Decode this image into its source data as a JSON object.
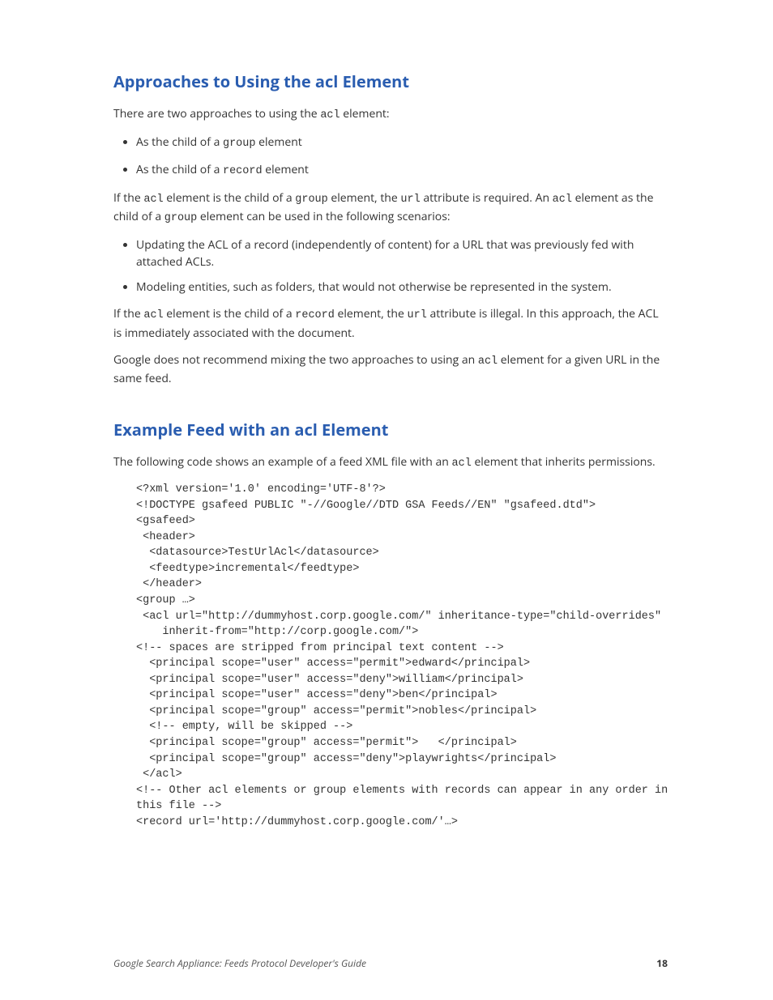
{
  "section1": {
    "heading": "Approaches to Using the acl Element",
    "intro_before": "There are two approaches to using the ",
    "intro_code": "acl",
    "intro_after": " element:",
    "bullets_a": [
      {
        "before": "As the child of a ",
        "code": "group",
        "after": " element"
      },
      {
        "before": "As the child of a ",
        "code": "record",
        "after": " element"
      }
    ],
    "p2_1": "If the ",
    "p2_c1": "acl",
    "p2_2": " element is the child of a ",
    "p2_c2": "group",
    "p2_3": " element, the ",
    "p2_c3": "url",
    "p2_4": " attribute is required. An ",
    "p2_c4": "acl",
    "p2_5": " element as the child of a ",
    "p2_c5": "group",
    "p2_6": " element can be used in the following scenarios:",
    "bullets_b": [
      "Updating the ACL of a record (independently of content) for a URL that was previously fed with attached ACLs.",
      "Modeling entities, such as folders, that would not otherwise be represented in the system."
    ],
    "p3_1": "If the ",
    "p3_c1": "acl",
    "p3_2": " element is the child of a ",
    "p3_c2": "record",
    "p3_3": " element, the ",
    "p3_c3": "url",
    "p3_4": " attribute is illegal. In this approach, the ACL is immediately associated with the document.",
    "p4_1": "Google does not recommend mixing the two approaches to using an ",
    "p4_c1": "acl",
    "p4_2": " element for a given URL in the same feed."
  },
  "section2": {
    "heading": "Example Feed with an acl Element",
    "intro_1": "The following code shows an example of a feed XML file with an ",
    "intro_c": "acl",
    "intro_2": " element that inherits permissions.",
    "code": "<?xml version='1.0' encoding='UTF-8'?>\n<!DOCTYPE gsafeed PUBLIC \"-//Google//DTD GSA Feeds//EN\" \"gsafeed.dtd\">\n<gsafeed>\n <header>\n  <datasource>TestUrlAcl</datasource>\n  <feedtype>incremental</feedtype>\n </header>\n<group …>\n <acl url=\"http://dummyhost.corp.google.com/\" inheritance-type=\"child-overrides\"\n    inherit-from=\"http://corp.google.com/\">\n<!-- spaces are stripped from principal text content -->\n  <principal scope=\"user\" access=\"permit\">edward</principal>\n  <principal scope=\"user\" access=\"deny\">william</principal>\n  <principal scope=\"user\" access=\"deny\">ben</principal>\n  <principal scope=\"group\" access=\"permit\">nobles</principal>\n  <!-- empty, will be skipped -->\n  <principal scope=\"group\" access=\"permit\">   </principal>\n  <principal scope=\"group\" access=\"deny\">playwrights</principal>\n </acl>\n<!-- Other acl elements or group elements with records can appear in any order in\nthis file -->\n<record url='http://dummyhost.corp.google.com/'…>"
  },
  "footer": {
    "title": "Google Search Appliance: Feeds Protocol Developer's Guide",
    "page": "18"
  }
}
